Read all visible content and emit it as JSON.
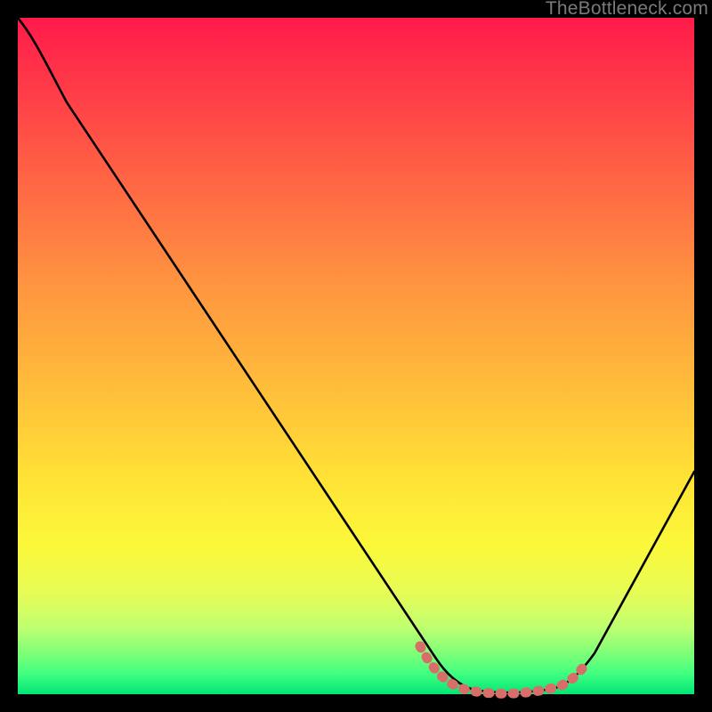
{
  "watermark": "TheBottleneck.com",
  "colors": {
    "frame": "#000000",
    "curve": "#000000",
    "highlight": "#d86e6a",
    "gradient_top": "#ff1a4a",
    "gradient_bottom": "#00e676"
  },
  "chart_data": {
    "type": "line",
    "title": "",
    "xlabel": "",
    "ylabel": "",
    "xlim": [
      0,
      100
    ],
    "ylim": [
      0,
      100
    ],
    "grid": false,
    "legend": false,
    "x": [
      0,
      3,
      10,
      20,
      30,
      40,
      50,
      56,
      60,
      64,
      68,
      72,
      76,
      80,
      84,
      88,
      92,
      96,
      100
    ],
    "y": [
      100,
      96,
      84,
      69,
      54,
      40,
      25,
      15,
      9,
      4,
      1,
      0,
      0,
      0,
      2,
      6,
      13,
      22,
      33
    ],
    "highlight_range_x": [
      59,
      82
    ],
    "annotations": []
  }
}
